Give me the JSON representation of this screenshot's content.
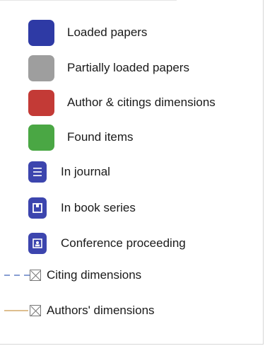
{
  "legend": {
    "items": [
      {
        "label": "Loaded papers",
        "color": "#2e3aa5",
        "icon": "square-swatch"
      },
      {
        "label": "Partially loaded papers",
        "color": "#9e9e9e",
        "icon": "square-swatch"
      },
      {
        "label": "Author & citings dimensions",
        "color": "#c33a36",
        "icon": "square-swatch"
      },
      {
        "label": "Found items",
        "color": "#4aa744",
        "icon": "square-swatch"
      },
      {
        "label": "In journal",
        "color": "#3c45ae",
        "icon": "journal-lines-icon"
      },
      {
        "label": "In book series",
        "color": "#3c45ae",
        "icon": "book-series-icon"
      },
      {
        "label": "Conference proceeding",
        "color": "#3c45ae",
        "icon": "conference-icon"
      }
    ],
    "lines": [
      {
        "label": "Citing dimensions",
        "style": "dashed",
        "color": "#6a86c8",
        "icon": "checkbox-x-icon"
      },
      {
        "label": "Authors' dimensions",
        "style": "solid",
        "color": "#d4a86a",
        "icon": "checkbox-x-icon"
      }
    ]
  }
}
